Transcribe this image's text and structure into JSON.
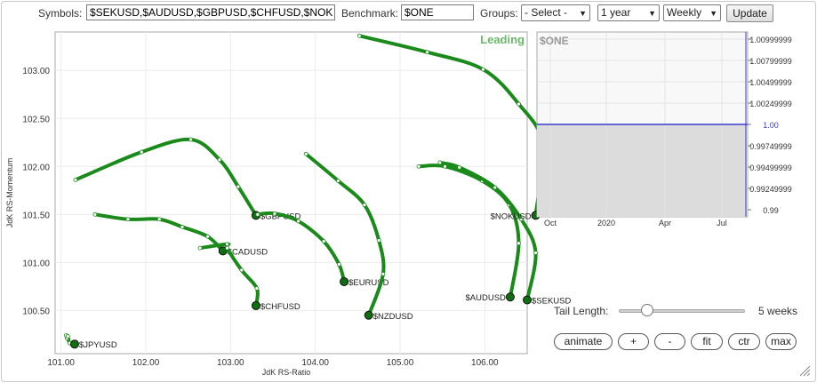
{
  "toolbar": {
    "symbols_label": "Symbols:",
    "symbols_value": "$SEKUSD,$AUDUSD,$GBPUSD,$CHFUSD,$NOK",
    "benchmark_label": "Benchmark:",
    "benchmark_value": "$ONE",
    "groups_label": "Groups:",
    "groups_value": "- Select -",
    "period_value": "1 year",
    "frequency_value": "Weekly",
    "update_label": "Update"
  },
  "chart_data": [
    {
      "type": "scatter",
      "title": "",
      "quadrant_label": "Leading",
      "xlabel": "JdK RS-Ratio",
      "ylabel": "JdK RS-Momentum",
      "xlim": [
        100.93,
        106.5
      ],
      "ylim": [
        100.05,
        103.4
      ],
      "xticks": [
        101.0,
        102.0,
        103.0,
        104.0,
        105.0,
        106.0
      ],
      "yticks": [
        100.5,
        101.0,
        101.5,
        102.0,
        102.5,
        103.0
      ],
      "xtick_labels": [
        "101.00",
        "102.00",
        "103.00",
        "104.00",
        "105.00",
        "106.00"
      ],
      "ytick_labels": [
        "100.50",
        "101.00",
        "101.50",
        "102.00",
        "102.50",
        "103.00"
      ],
      "line_color": "#1a8a1a",
      "series": [
        {
          "name": "$JPYUSD",
          "x": [
            101.07,
            101.06,
            101.08,
            101.1,
            101.16
          ],
          "y": [
            100.21,
            100.24,
            100.23,
            100.16,
            100.15
          ]
        },
        {
          "name": "$CADUSD",
          "x": [
            101.4,
            101.79,
            102.16,
            102.43,
            102.73,
            102.91
          ],
          "y": [
            101.5,
            101.45,
            101.45,
            101.37,
            101.27,
            101.12
          ]
        },
        {
          "name": "$GBPUSD",
          "x": [
            101.17,
            101.95,
            102.53,
            102.87,
            103.09,
            103.3
          ],
          "y": [
            101.86,
            102.15,
            102.28,
            102.07,
            101.79,
            101.49
          ]
        },
        {
          "name": "$CHFUSD",
          "x": [
            102.64,
            102.96,
            102.96,
            103.13,
            103.31,
            103.3
          ],
          "y": [
            101.15,
            101.19,
            101.15,
            100.92,
            100.73,
            100.55
          ]
        },
        {
          "name": "$EURUSD",
          "x": [
            103.32,
            103.52,
            103.8,
            104.1,
            104.28,
            104.34
          ],
          "y": [
            101.5,
            101.51,
            101.43,
            101.22,
            100.98,
            100.8
          ]
        },
        {
          "name": "$NZDUSD",
          "x": [
            103.89,
            104.27,
            104.58,
            104.75,
            104.8,
            104.63
          ],
          "y": [
            102.13,
            101.85,
            101.6,
            101.23,
            100.88,
            100.45
          ]
        },
        {
          "name": "$AUDUSD",
          "x": [
            105.22,
            105.53,
            105.97,
            106.29,
            106.4,
            106.3
          ],
          "y": [
            102.0,
            102.0,
            101.85,
            101.6,
            101.2,
            100.64
          ]
        },
        {
          "name": "$SEKUSD",
          "x": [
            105.47,
            105.7,
            106.12,
            106.43,
            106.6,
            106.5
          ],
          "y": [
            102.04,
            101.99,
            101.78,
            101.45,
            101.1,
            100.61
          ]
        },
        {
          "name": "$NOKUSD",
          "x": [
            104.52,
            105.32,
            105.98,
            106.4,
            106.68,
            106.6
          ],
          "y": [
            103.36,
            103.19,
            103.01,
            102.65,
            102.24,
            101.49
          ]
        }
      ]
    },
    {
      "type": "line",
      "title": "$ONE",
      "xtick_labels": [
        "Oct",
        "2020",
        "Apr",
        "Jul"
      ],
      "ytick_labels": [
        "1.00999999",
        "1.00799999",
        "1.00499999",
        "1.00249999",
        "1.00",
        "0.99749999",
        "0.99499999",
        "0.99249999",
        "0.99"
      ],
      "ylim": [
        0.9875,
        1.0105
      ],
      "value": 1.0,
      "line_color": "#3a3acc"
    }
  ],
  "controls": {
    "tail_label": "Tail Length:",
    "tail_value": 5,
    "tail_max": 26,
    "tail_value_label": "5 weeks",
    "buttons": [
      "animate",
      "+",
      "-",
      "fit",
      "ctr",
      "max"
    ]
  }
}
